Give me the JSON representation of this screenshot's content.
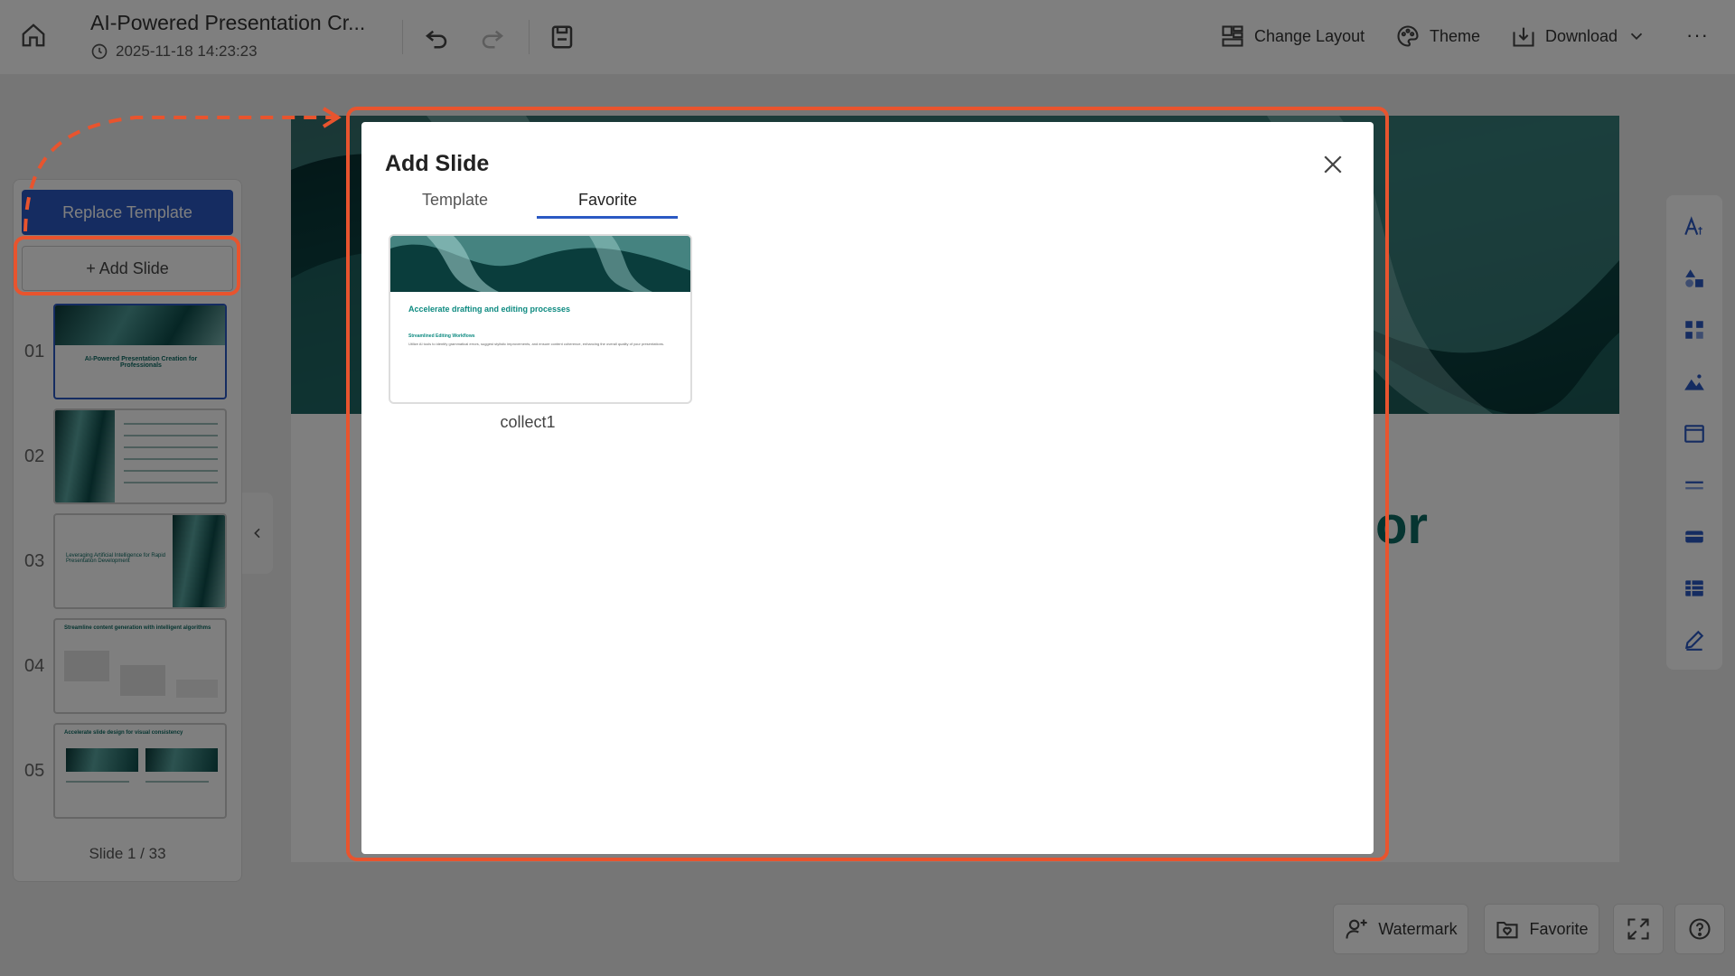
{
  "header": {
    "doc_title": "AI-Powered Presentation Cr...",
    "timestamp": "2025-11-18 14:23:23",
    "change_layout_label": "Change Layout",
    "theme_label": "Theme",
    "download_label": "Download",
    "more_label": "···"
  },
  "sidebar": {
    "replace_template_label": "Replace Template",
    "add_slide_label": "+ Add Slide",
    "slides": [
      {
        "num": "01",
        "title": "AI-Powered Presentation Creation for Professionals"
      },
      {
        "num": "02"
      },
      {
        "num": "03",
        "title": "Leveraging Artificial Intelligence for Rapid Presentation Development"
      },
      {
        "num": "04",
        "title": "Streamline content generation with intelligent algorithms"
      },
      {
        "num": "05",
        "title": "Accelerate slide design for visual consistency"
      }
    ],
    "counter": "Slide 1 / 33",
    "collapse_icon": "chevron-left-icon"
  },
  "canvas": {
    "visible_text": "or"
  },
  "bottom": {
    "watermark_label": "Watermark",
    "favorite_label": "Favorite"
  },
  "modal": {
    "title": "Add Slide",
    "tabs": [
      {
        "label": "Template",
        "active": false
      },
      {
        "label": "Favorite",
        "active": true
      }
    ],
    "favorites": [
      {
        "name": "collect1",
        "heading": "Accelerate drafting and editing processes",
        "subheading": "Streamlined Editing Workflows",
        "body": "Utilize AI tools to identify grammatical errors, suggest stylistic improvements, and ensure content coherence, enhancing the overall quality of your presentations."
      }
    ]
  },
  "colors": {
    "accent": "#2b59c3",
    "teal": "#0d6b63",
    "highlight": "#e8542e"
  }
}
